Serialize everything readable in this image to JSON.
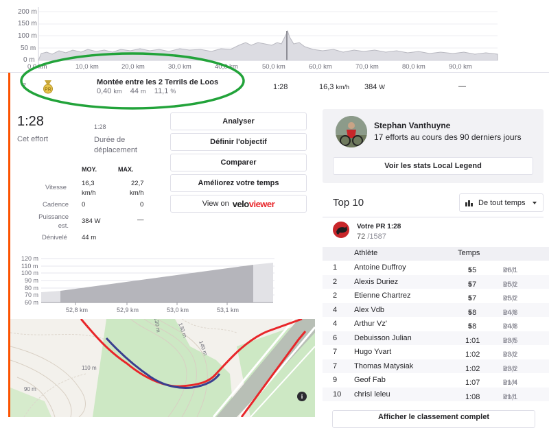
{
  "top_chart": {
    "y_ticks": [
      "200 m",
      "150 m",
      "100 m",
      "50 m",
      "0 m"
    ],
    "x_ticks": [
      "0,0 km",
      "10,0 km",
      "20,0 km",
      "30,0 km",
      "40,0 km",
      "50,0 km",
      "60,0 km",
      "70,0 km",
      "80,0 km",
      "90,0 km"
    ]
  },
  "segment_row": {
    "index": "7",
    "name": "Montée entre les 2 Terrils de Loos",
    "distance": "0,40",
    "distance_unit": "km",
    "elevation": "44",
    "elevation_unit": "m",
    "grade": "11,1",
    "grade_unit": "%",
    "time": "1:28",
    "speed": "16,3",
    "speed_unit": "km/h",
    "power": "384",
    "power_unit": "W",
    "hr": "—"
  },
  "effort": {
    "time": "1:28",
    "time_label": "Cet effort",
    "moving_time": "1:28",
    "moving_label_1": "Durée de",
    "moving_label_2": "déplacement",
    "col_avg": "MOY.",
    "col_max": "MAX.",
    "rows": {
      "speed_label": "Vitesse",
      "speed_avg": "16,3",
      "speed_max": "22,7",
      "unit_kmh": "km/h",
      "cadence_label": "Cadence",
      "cadence_avg": "0",
      "cadence_max": "0",
      "power_label_1": "Puissance",
      "power_label_2": "est.",
      "power_avg": "384 W",
      "power_max": "—",
      "elev_label": "Dénivelé",
      "elev_val": "44 m"
    }
  },
  "actions": {
    "analyze": "Analyser",
    "goal": "Définir l'objectif",
    "compare": "Comparer",
    "improve": "Améliorez votre temps",
    "view_on": "View on",
    "velo": "velo",
    "viewer": "viewer"
  },
  "mini_chart": {
    "y_ticks": [
      "120 m",
      "110 m",
      "100 m",
      "90 m",
      "80 m",
      "70 m",
      "60 m"
    ],
    "x_ticks": [
      "52,8 km",
      "52,9 km",
      "53,0 km",
      "53,1 km"
    ]
  },
  "map": {
    "contour_labels": [
      "130 m",
      "130 m",
      "140 m",
      "90 m",
      "110 m"
    ],
    "info_icon": "i"
  },
  "local_legend": {
    "name": "Stephan Vanthuyne",
    "efforts": "17 efforts au cours des 90 derniers jours",
    "button": "Voir les stats Local Legend"
  },
  "leaderboard": {
    "title": "Top 10",
    "filter": "De tout temps",
    "pr_label": "Votre PR 1:28",
    "rank": "72",
    "total": "/1587",
    "col_athlete": "Athlète",
    "col_time": "Temps",
    "unit": "km/h",
    "rows": [
      {
        "rank": "1",
        "name": "Antoine Duffroy",
        "time": "55",
        "time_unit": "s",
        "speed": "26,1"
      },
      {
        "rank": "2",
        "name": "Alexis Duriez",
        "time": "57",
        "time_unit": "s",
        "speed": "25,2"
      },
      {
        "rank": "2",
        "name": "Etienne Chartrez",
        "time": "57",
        "time_unit": "s",
        "speed": "25,2"
      },
      {
        "rank": "4",
        "name": "Alex Vdb",
        "time": "58",
        "time_unit": "s",
        "speed": "24,8"
      },
      {
        "rank": "4",
        "name": "Arthur Vz'",
        "time": "58",
        "time_unit": "s",
        "speed": "24,8"
      },
      {
        "rank": "6",
        "name": "Debuisson Julian",
        "time": "1:01",
        "time_unit": "",
        "speed": "23,5"
      },
      {
        "rank": "7",
        "name": "Hugo Yvart",
        "time": "1:02",
        "time_unit": "",
        "speed": "23,2"
      },
      {
        "rank": "7",
        "name": "Thomas Matysiak",
        "time": "1:02",
        "time_unit": "",
        "speed": "23,2"
      },
      {
        "rank": "9",
        "name": "Geof Fab",
        "time": "1:07",
        "time_unit": "",
        "speed": "21,4"
      },
      {
        "rank": "10",
        "name": "chrisI leleu",
        "time": "1:08",
        "time_unit": "",
        "speed": "21,1"
      }
    ],
    "full_button": "Afficher le classement complet"
  },
  "colors": {
    "accent": "#fc5200",
    "annotation_green": "#22a33a",
    "route_blue": "#3a3f8f",
    "route_red": "#e8262a"
  }
}
